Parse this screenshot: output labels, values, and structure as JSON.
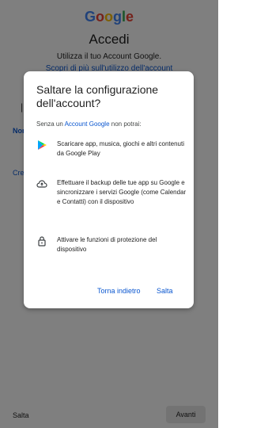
{
  "background": {
    "logo_letters": [
      "G",
      "o",
      "o",
      "g",
      "l",
      "e"
    ],
    "logo_colors": [
      "#4285f4",
      "#ea4335",
      "#fbbc05",
      "#4285f4",
      "#34a853",
      "#ea4335"
    ],
    "title": "Accedi",
    "subtitle": "Utilizza il tuo Account Google.",
    "learn_more": "Scopri di più sull'utilizzo dell'account",
    "field_label_1": "Nom",
    "field_label_2": "Crea",
    "skip_label": "Salta",
    "next_label": "Avanti"
  },
  "dialog": {
    "title": "Saltare la configurazione dell'account?",
    "intro_prefix": "Senza un ",
    "intro_accent": "Account Google",
    "intro_suffix": " non potrai:",
    "items": [
      {
        "icon": "google-play-icon",
        "text": "Scaricare app, musica, giochi e altri contenuti da Google Play"
      },
      {
        "icon": "cloud-upload-icon",
        "text": "Effettuare il backup delle tue app su Google e sincronizzare i servizi Google (come Calendar e Contatti) con il dispositivo"
      },
      {
        "icon": "lock-icon",
        "text": "Attivare le funzioni di protezione del dispositivo"
      }
    ],
    "back_label": "Torna indietro",
    "skip_label": "Salta"
  },
  "colors": {
    "accent": "#0b57d0",
    "text": "#1f1f1f",
    "scrim": "rgba(0,0,0,0.5)"
  }
}
